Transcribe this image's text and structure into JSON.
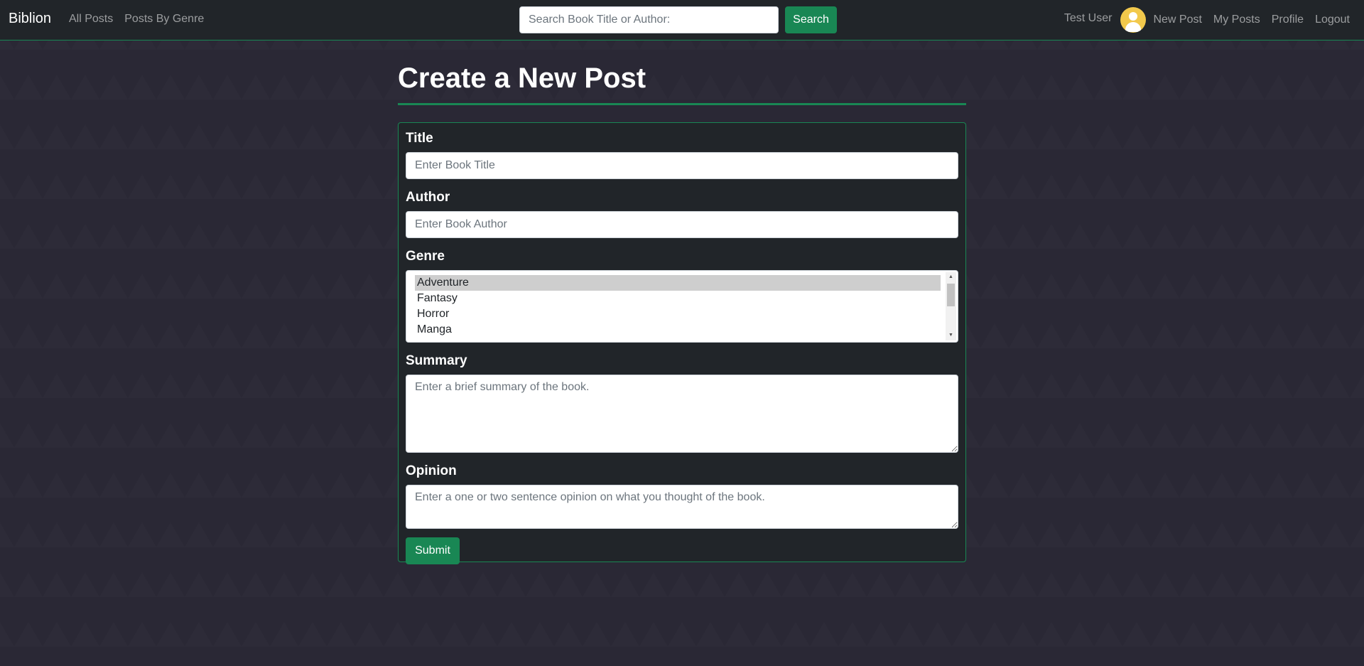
{
  "navbar": {
    "brand": "Biblion",
    "links": [
      "All Posts",
      "Posts By Genre"
    ],
    "search_placeholder": "Search Book Title or Author:",
    "search_button": "Search",
    "user_name": "Test User",
    "right_links": [
      "New Post",
      "My Posts",
      "Profile",
      "Logout"
    ]
  },
  "page": {
    "title": "Create a New Post"
  },
  "form": {
    "title_label": "Title",
    "title_placeholder": "Enter Book Title",
    "author_label": "Author",
    "author_placeholder": "Enter Book Author",
    "genre_label": "Genre",
    "genre_options": [
      "Adventure",
      "Fantasy",
      "Horror",
      "Manga"
    ],
    "genre_selected": "Adventure",
    "summary_label": "Summary",
    "summary_placeholder": "Enter a brief summary of the book.",
    "opinion_label": "Opinion",
    "opinion_placeholder": "Enter a one or two sentence opinion on what you thought of the book.",
    "submit_label": "Submit"
  },
  "colors": {
    "accent": "#198754",
    "navbar_bg": "#212529",
    "page_bg": "#2a2835",
    "avatar": "#f2c94c"
  },
  "icons": [
    "user-avatar-icon",
    "scroll-up-arrow-icon",
    "scroll-down-arrow-icon"
  ]
}
